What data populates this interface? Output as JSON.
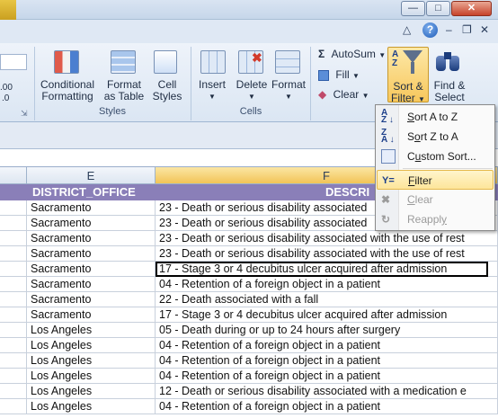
{
  "ribbon": {
    "styles_group": {
      "label": "Styles",
      "conditional_formatting": [
        "Conditional",
        "Formatting"
      ],
      "format_as_table": [
        "Format",
        "as Table"
      ],
      "cell_styles": [
        "Cell",
        "Styles"
      ]
    },
    "cells_group": {
      "label": "Cells",
      "insert": "Insert",
      "delete": "Delete",
      "format": "Format"
    },
    "editing_group": {
      "autosum": "AutoSum",
      "fill": "Fill",
      "clear": "Clear",
      "sort_filter": [
        "Sort &",
        "Filter"
      ],
      "find_select": [
        "Find &",
        "Select"
      ]
    },
    "number_fragments": [
      ".00",
      ".0"
    ]
  },
  "columns": {
    "e": "E",
    "f": "F"
  },
  "sheet": {
    "headers": {
      "district": "DISTRICT_OFFICE",
      "description": "DESCRI"
    },
    "rows": [
      {
        "district": "Sacramento",
        "description": "23 - Death or serious disability associated"
      },
      {
        "district": "Sacramento",
        "description": "23 - Death or serious disability associated"
      },
      {
        "district": "Sacramento",
        "description": "23 - Death or serious disability associated with the use of rest"
      },
      {
        "district": "Sacramento",
        "description": "23 - Death or serious disability associated with the use of rest"
      },
      {
        "district": "Sacramento",
        "description": "17 - Stage 3 or 4 decubitus ulcer acquired after admission"
      },
      {
        "district": "Sacramento",
        "description": "04 - Retention of a foreign object in a patient"
      },
      {
        "district": "Sacramento",
        "description": "22 - Death associated with a fall"
      },
      {
        "district": "Sacramento",
        "description": "17 - Stage 3 or 4 decubitus ulcer acquired after admission"
      },
      {
        "district": "Los Angeles",
        "description": "05 - Death during or up to 24 hours after surgery"
      },
      {
        "district": "Los Angeles",
        "description": "04 - Retention of a foreign object in a patient"
      },
      {
        "district": "Los Angeles",
        "description": "04 - Retention of a foreign object in a patient"
      },
      {
        "district": "Los Angeles",
        "description": "04 - Retention of a foreign object in a patient"
      },
      {
        "district": "Los Angeles",
        "description": "12 - Death or serious disability associated with a medication e"
      },
      {
        "district": "Los Angeles",
        "description": "04 - Retention of a foreign object in a patient"
      }
    ]
  },
  "menu": {
    "sort_az": "Sort A to Z",
    "sort_za": "Sort Z to A",
    "custom_sort": "Custom Sort...",
    "filter": "Filter",
    "clear": "Clear",
    "reapply": "Reapply"
  },
  "colors": {
    "header_band": "#8a7fb8",
    "highlight": "#fde59a"
  }
}
